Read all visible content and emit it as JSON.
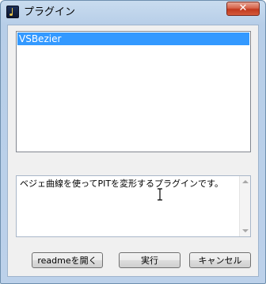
{
  "window": {
    "title": "プラグイン",
    "close_glyph": "✕"
  },
  "plugin_list": {
    "items": [
      "VSBezier"
    ],
    "selected": "VSBezier"
  },
  "description": {
    "text": "ベジェ曲線を使ってPITを変形するプラグインです。"
  },
  "buttons": {
    "readme_label": "readmeを開く",
    "run_label": "実行",
    "cancel_label": "キャンセル"
  },
  "icons": {
    "app": "app-music-icon",
    "close": "close-icon",
    "cursor": "text-cursor-icon"
  },
  "colors": {
    "selection": "#3399ff",
    "close_button": "#c1391e",
    "frame": "#b7cee8"
  }
}
